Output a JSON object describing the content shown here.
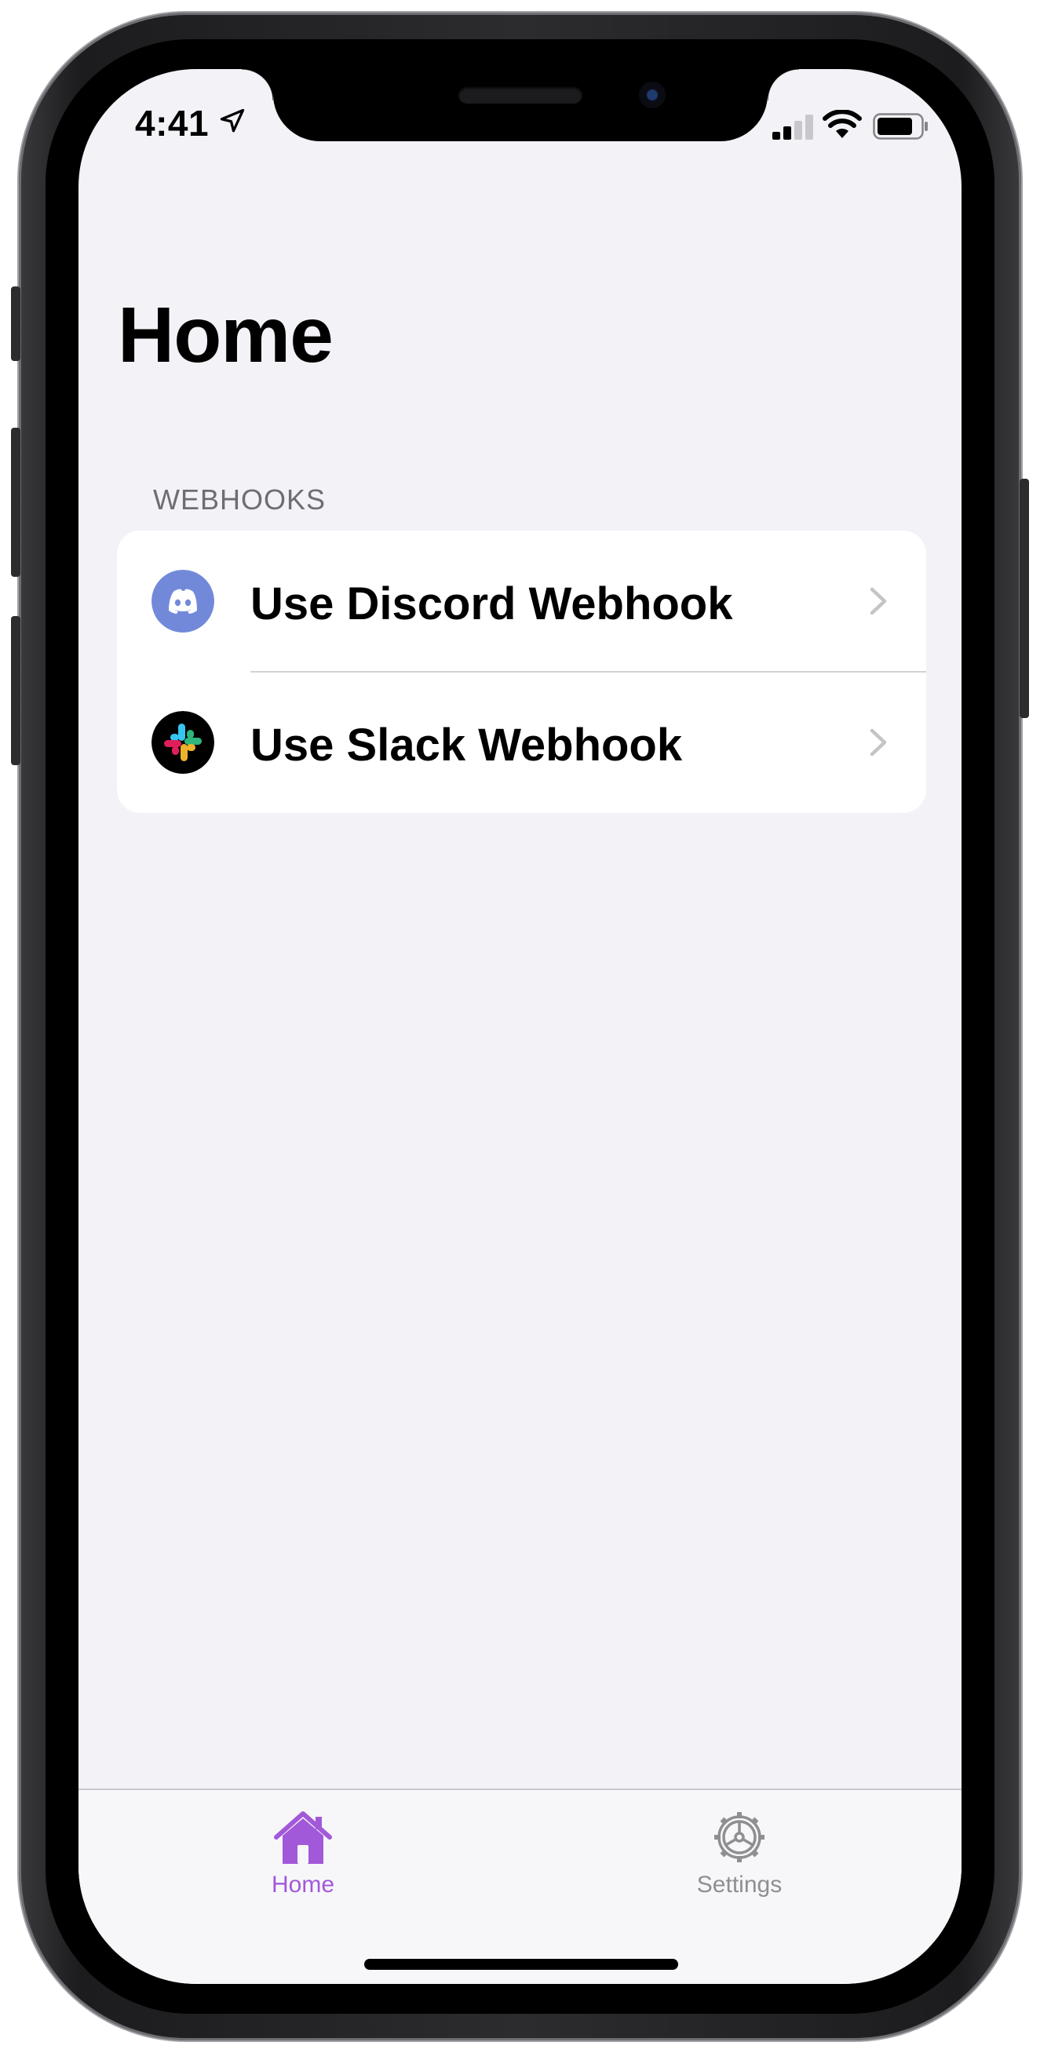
{
  "status_bar": {
    "time": "4:41",
    "icons": [
      "location-arrow-icon",
      "cellular-signal-icon",
      "wifi-icon",
      "battery-icon"
    ]
  },
  "page": {
    "title": "Home"
  },
  "webhooks_section": {
    "header": "WEBHOOKS",
    "items": [
      {
        "label": "Use Discord Webhook",
        "icon": "discord-icon",
        "icon_color": "#7289da"
      },
      {
        "label": "Use Slack Webhook",
        "icon": "slack-icon",
        "icon_color": "#000000"
      }
    ]
  },
  "tab_bar": {
    "active_color": "#a259d9",
    "inactive_color": "#8e8e93",
    "tabs": [
      {
        "label": "Home",
        "icon": "house-icon",
        "active": true
      },
      {
        "label": "Settings",
        "icon": "gear-icon",
        "active": false
      }
    ]
  },
  "colors": {
    "background": "#f2f2f7",
    "card": "#ffffff",
    "section_header": "#6d6d72",
    "chevron": "#c4c4c7"
  }
}
